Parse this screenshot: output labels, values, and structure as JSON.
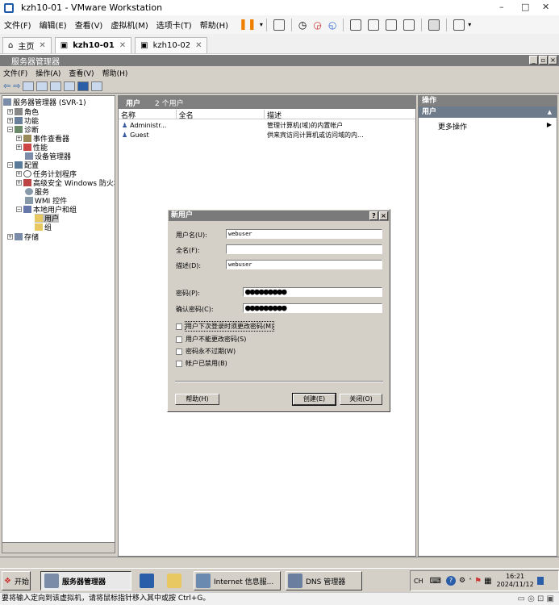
{
  "vm": {
    "title": "kzh10-01 - VMware Workstation",
    "menu": [
      "文件(F)",
      "编辑(E)",
      "查看(V)",
      "虚拟机(M)",
      "选项卡(T)",
      "帮助(H)"
    ],
    "tabs": [
      {
        "label": "主页"
      },
      {
        "label": "kzh10-01"
      },
      {
        "label": "kzh10-02"
      }
    ],
    "status": "要将输入定向到该虚拟机，请将鼠标指针移入其中或按 Ctrl+G。"
  },
  "sm": {
    "title": "服务器管理器",
    "menu": [
      "文件(F)",
      "操作(A)",
      "查看(V)",
      "帮助(H)"
    ],
    "tree": {
      "root": "服务器管理器 (SVR-1)",
      "roles": "角色",
      "features": "功能",
      "diagnostics": "诊断",
      "event_viewer": "事件查看器",
      "performance": "性能",
      "device_manager": "设备管理器",
      "config": "配置",
      "task_scheduler": "任务计划程序",
      "firewall": "高级安全 Windows 防火墙",
      "services": "服务",
      "wmi": "WMI 控件",
      "local_users": "本地用户和组",
      "users": "用户",
      "groups": "组",
      "storage": "存储"
    },
    "list": {
      "header": "用户",
      "count": "2 个用户",
      "columns": [
        "名称",
        "全名",
        "描述"
      ],
      "rows": [
        {
          "name": "Administr...",
          "fullname": "",
          "desc": "管理计算机(域)的内置帐户"
        },
        {
          "name": "Guest",
          "fullname": "",
          "desc": "供来宾访问计算机或访问域的内..."
        }
      ]
    },
    "actions": {
      "header": "操作",
      "sub": "用户",
      "more": "更多操作"
    }
  },
  "dialog": {
    "title": "新用户",
    "help_glyph": "?",
    "close_glyph": "×",
    "username_label": "用户名(U):",
    "username": "webuser",
    "fullname_label": "全名(F):",
    "fullname": "",
    "desc_label": "描述(D):",
    "desc": "webuser",
    "password_label": "密码(P):",
    "password": "●●●●●●●●●",
    "confirm_label": "确认密码(C):",
    "confirm": "●●●●●●●●●",
    "chk_must_change": "用户下次登录时须更改密码(M)",
    "chk_cannot_change": "用户不能更改密码(S)",
    "chk_never_expires": "密码永不过期(W)",
    "chk_disabled": "帐户已禁用(B)",
    "help_button": "帮助(H)",
    "create_button": "创建(E)",
    "close_button": "关闭(O)"
  },
  "taskbar": {
    "start": "开始",
    "items": [
      "服务器管理器",
      "Internet 信息服...",
      "DNS 管理器"
    ],
    "lang": "CH",
    "time": "16:21",
    "date": "2024/11/12"
  }
}
